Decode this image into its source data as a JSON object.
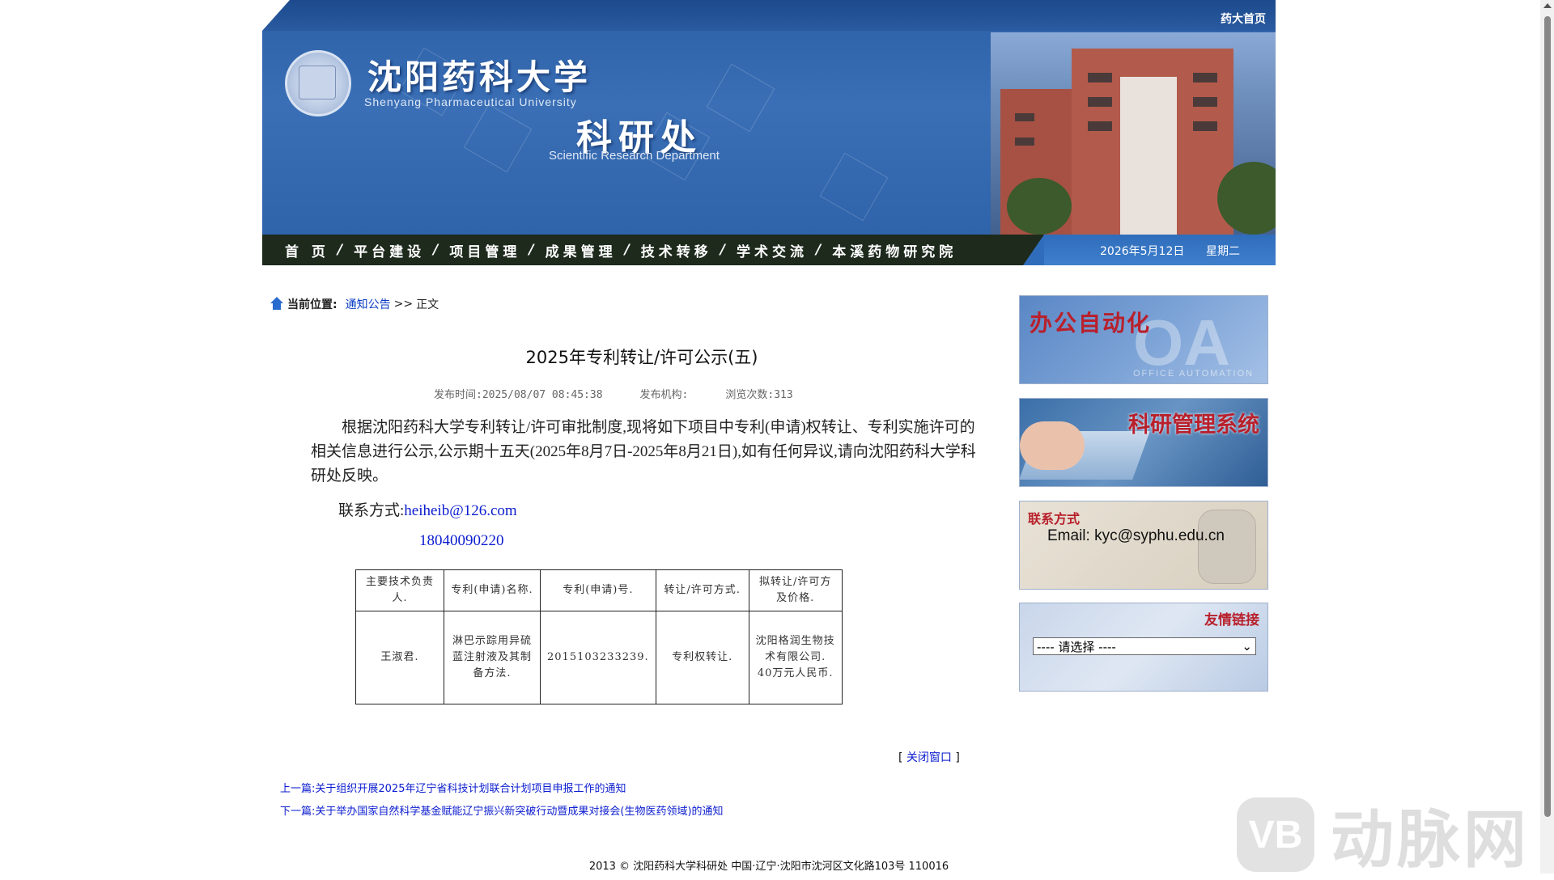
{
  "header": {
    "home_link": "药大首页",
    "univ_cn": "沈阳药科大学",
    "univ_en": "Shenyang Pharmaceutical University",
    "dept_cn": "科研处",
    "dept_en": "Scientific Research Department"
  },
  "nav": {
    "items": [
      "首 页",
      "平台建设",
      "项目管理",
      "成果管理",
      "技术转移",
      "学术交流",
      "本溪药物研究院"
    ],
    "separator": "/",
    "date": "2026年5月12日",
    "weekday": "星期二"
  },
  "breadcrumb": {
    "label": "当前位置:",
    "link": "通知公告",
    "arrow": ">>",
    "current": "正文"
  },
  "article": {
    "title": "2025年专利转让/许可公示(五)",
    "publish_time": "发布时间:2025/08/07 08:45:38",
    "publisher": "发布机构:",
    "views": "浏览次数:313",
    "body": "根据沈阳药科大学专利转让/许可审批制度,现将如下项目中专利(申请)权转让、专利实施许可的相关信息进行公示,公示期十五天(2025年8月7日-2025年8月21日),如有任何异议,请向沈阳药科大学科研处反映。",
    "contact_label": "联系方式:",
    "contact_email": "heiheib@126.com",
    "contact_phone": "18040090220"
  },
  "table": {
    "headers": [
      "主要技术负责人.",
      "专利(申请)名称.",
      "专利(申请)号.",
      "转让/许可方式.",
      "拟转让/许可方及价格."
    ],
    "rows": [
      [
        "王淑君.",
        "淋巴示踪用异硫蓝注射液及其制备方法.",
        "2015103233239.",
        "专利权转让.",
        "沈阳格润生物技术有限公司.\n40万元人民币."
      ]
    ]
  },
  "links": {
    "close_window": "关闭窗口",
    "prev_label": "上一篇:",
    "prev_title": "关于组织开展2025年辽宁省科技计划联合计划项目申报工作的通知",
    "next_label": "下一篇:",
    "next_title": "关于举办国家自然科学基金赋能辽宁振兴新突破行动暨成果对接会(生物医药领域)的通知"
  },
  "footer": {
    "text": "2013 © 沈阳药科大学科研处   中国·辽宁·沈阳市沈河区文化路103号  110016"
  },
  "sidebar": {
    "oa_title": "办公自动化",
    "oa_big": "OA",
    "oa_sub": "OFFICE AUTOMATION",
    "kyxt_title": "科研管理系统",
    "contact_title": "联系方式",
    "contact_email": "Email: kyc@syphu.edu.cn",
    "links_title": "友情链接",
    "links_select": "---- 请选择 ----"
  },
  "watermark": {
    "logo": "VB",
    "text": "动脉网"
  }
}
